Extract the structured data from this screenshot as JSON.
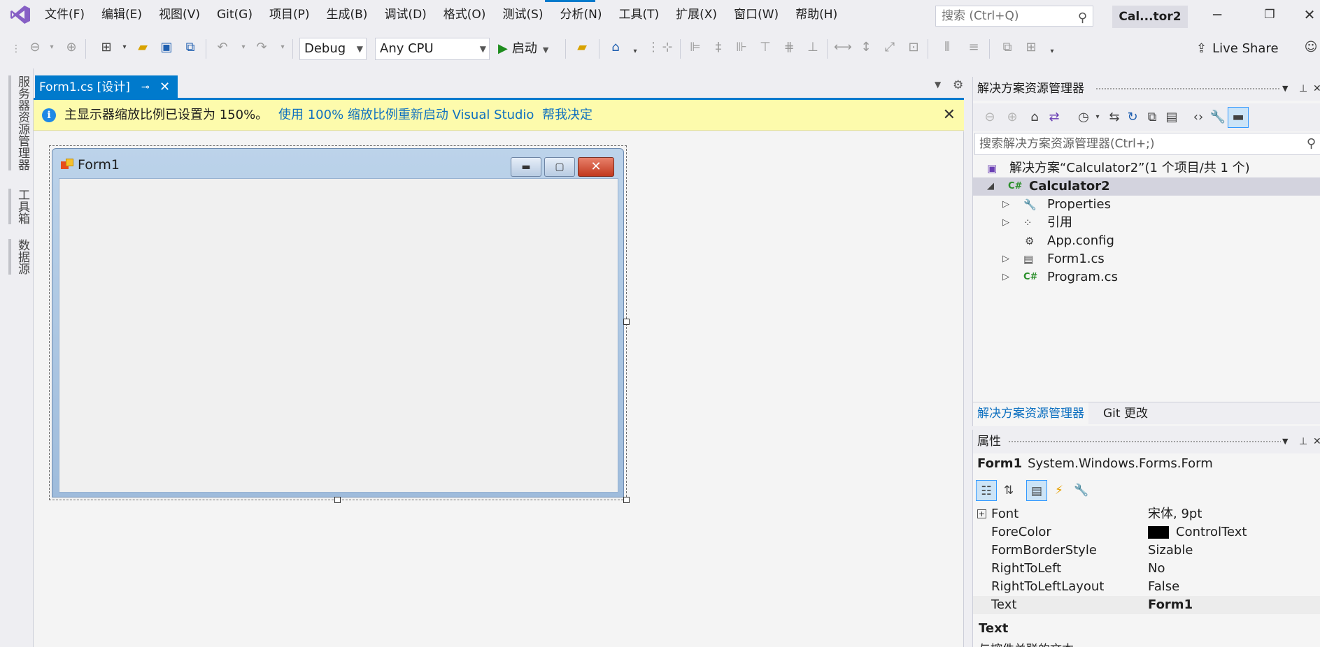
{
  "menu": {
    "items": [
      "文件(F)",
      "编辑(E)",
      "视图(V)",
      "Git(G)",
      "项目(P)",
      "生成(B)",
      "调试(D)",
      "格式(O)",
      "测试(S)",
      "分析(N)",
      "工具(T)",
      "扩展(X)",
      "窗口(W)",
      "帮助(H)"
    ],
    "search_placeholder": "搜索 (Ctrl+Q)",
    "solution_title": "Cal...tor2"
  },
  "toolbar": {
    "config": "Debug",
    "platform": "Any CPU",
    "start_label": "启动",
    "live_share": "Live Share"
  },
  "left_strip": {
    "tabs": [
      "服务器资源管理器",
      "工具箱",
      "数据源"
    ]
  },
  "document": {
    "tab_label": "Form1.cs [设计]"
  },
  "info_bar": {
    "message": "主显示器缩放比例已设置为 150%。",
    "link_restart": "使用 100% 缩放比例重新启动 Visual Studio",
    "link_decide": "帮我决定"
  },
  "form": {
    "title": "Form1"
  },
  "solution_explorer": {
    "title": "解决方案资源管理器",
    "search_placeholder": "搜索解决方案资源管理器(Ctrl+;)",
    "solution_node": "解决方案“Calculator2”(1 个项目/共 1 个)",
    "project_node": "Calculator2",
    "children": [
      "Properties",
      "引用",
      "App.config",
      "Form1.cs",
      "Program.cs"
    ],
    "tab_active": "解决方案资源管理器",
    "tab_git": "Git 更改"
  },
  "properties": {
    "title": "属性",
    "object_name": "Form1",
    "object_type": "System.Windows.Forms.Form",
    "rows": [
      {
        "name": "Font",
        "value": "宋体, 9pt"
      },
      {
        "name": "ForeColor",
        "value": "ControlText"
      },
      {
        "name": "FormBorderStyle",
        "value": "Sizable"
      },
      {
        "name": "RightToLeft",
        "value": "No"
      },
      {
        "name": "RightToLeftLayout",
        "value": "False"
      },
      {
        "name": "Text",
        "value": "Form1"
      }
    ],
    "desc_title": "Text",
    "desc_text": "与控件关联的文本。"
  },
  "colors": {
    "accent": "#007acc",
    "info_bar": "#fdfbac",
    "link": "#0e70c0"
  }
}
